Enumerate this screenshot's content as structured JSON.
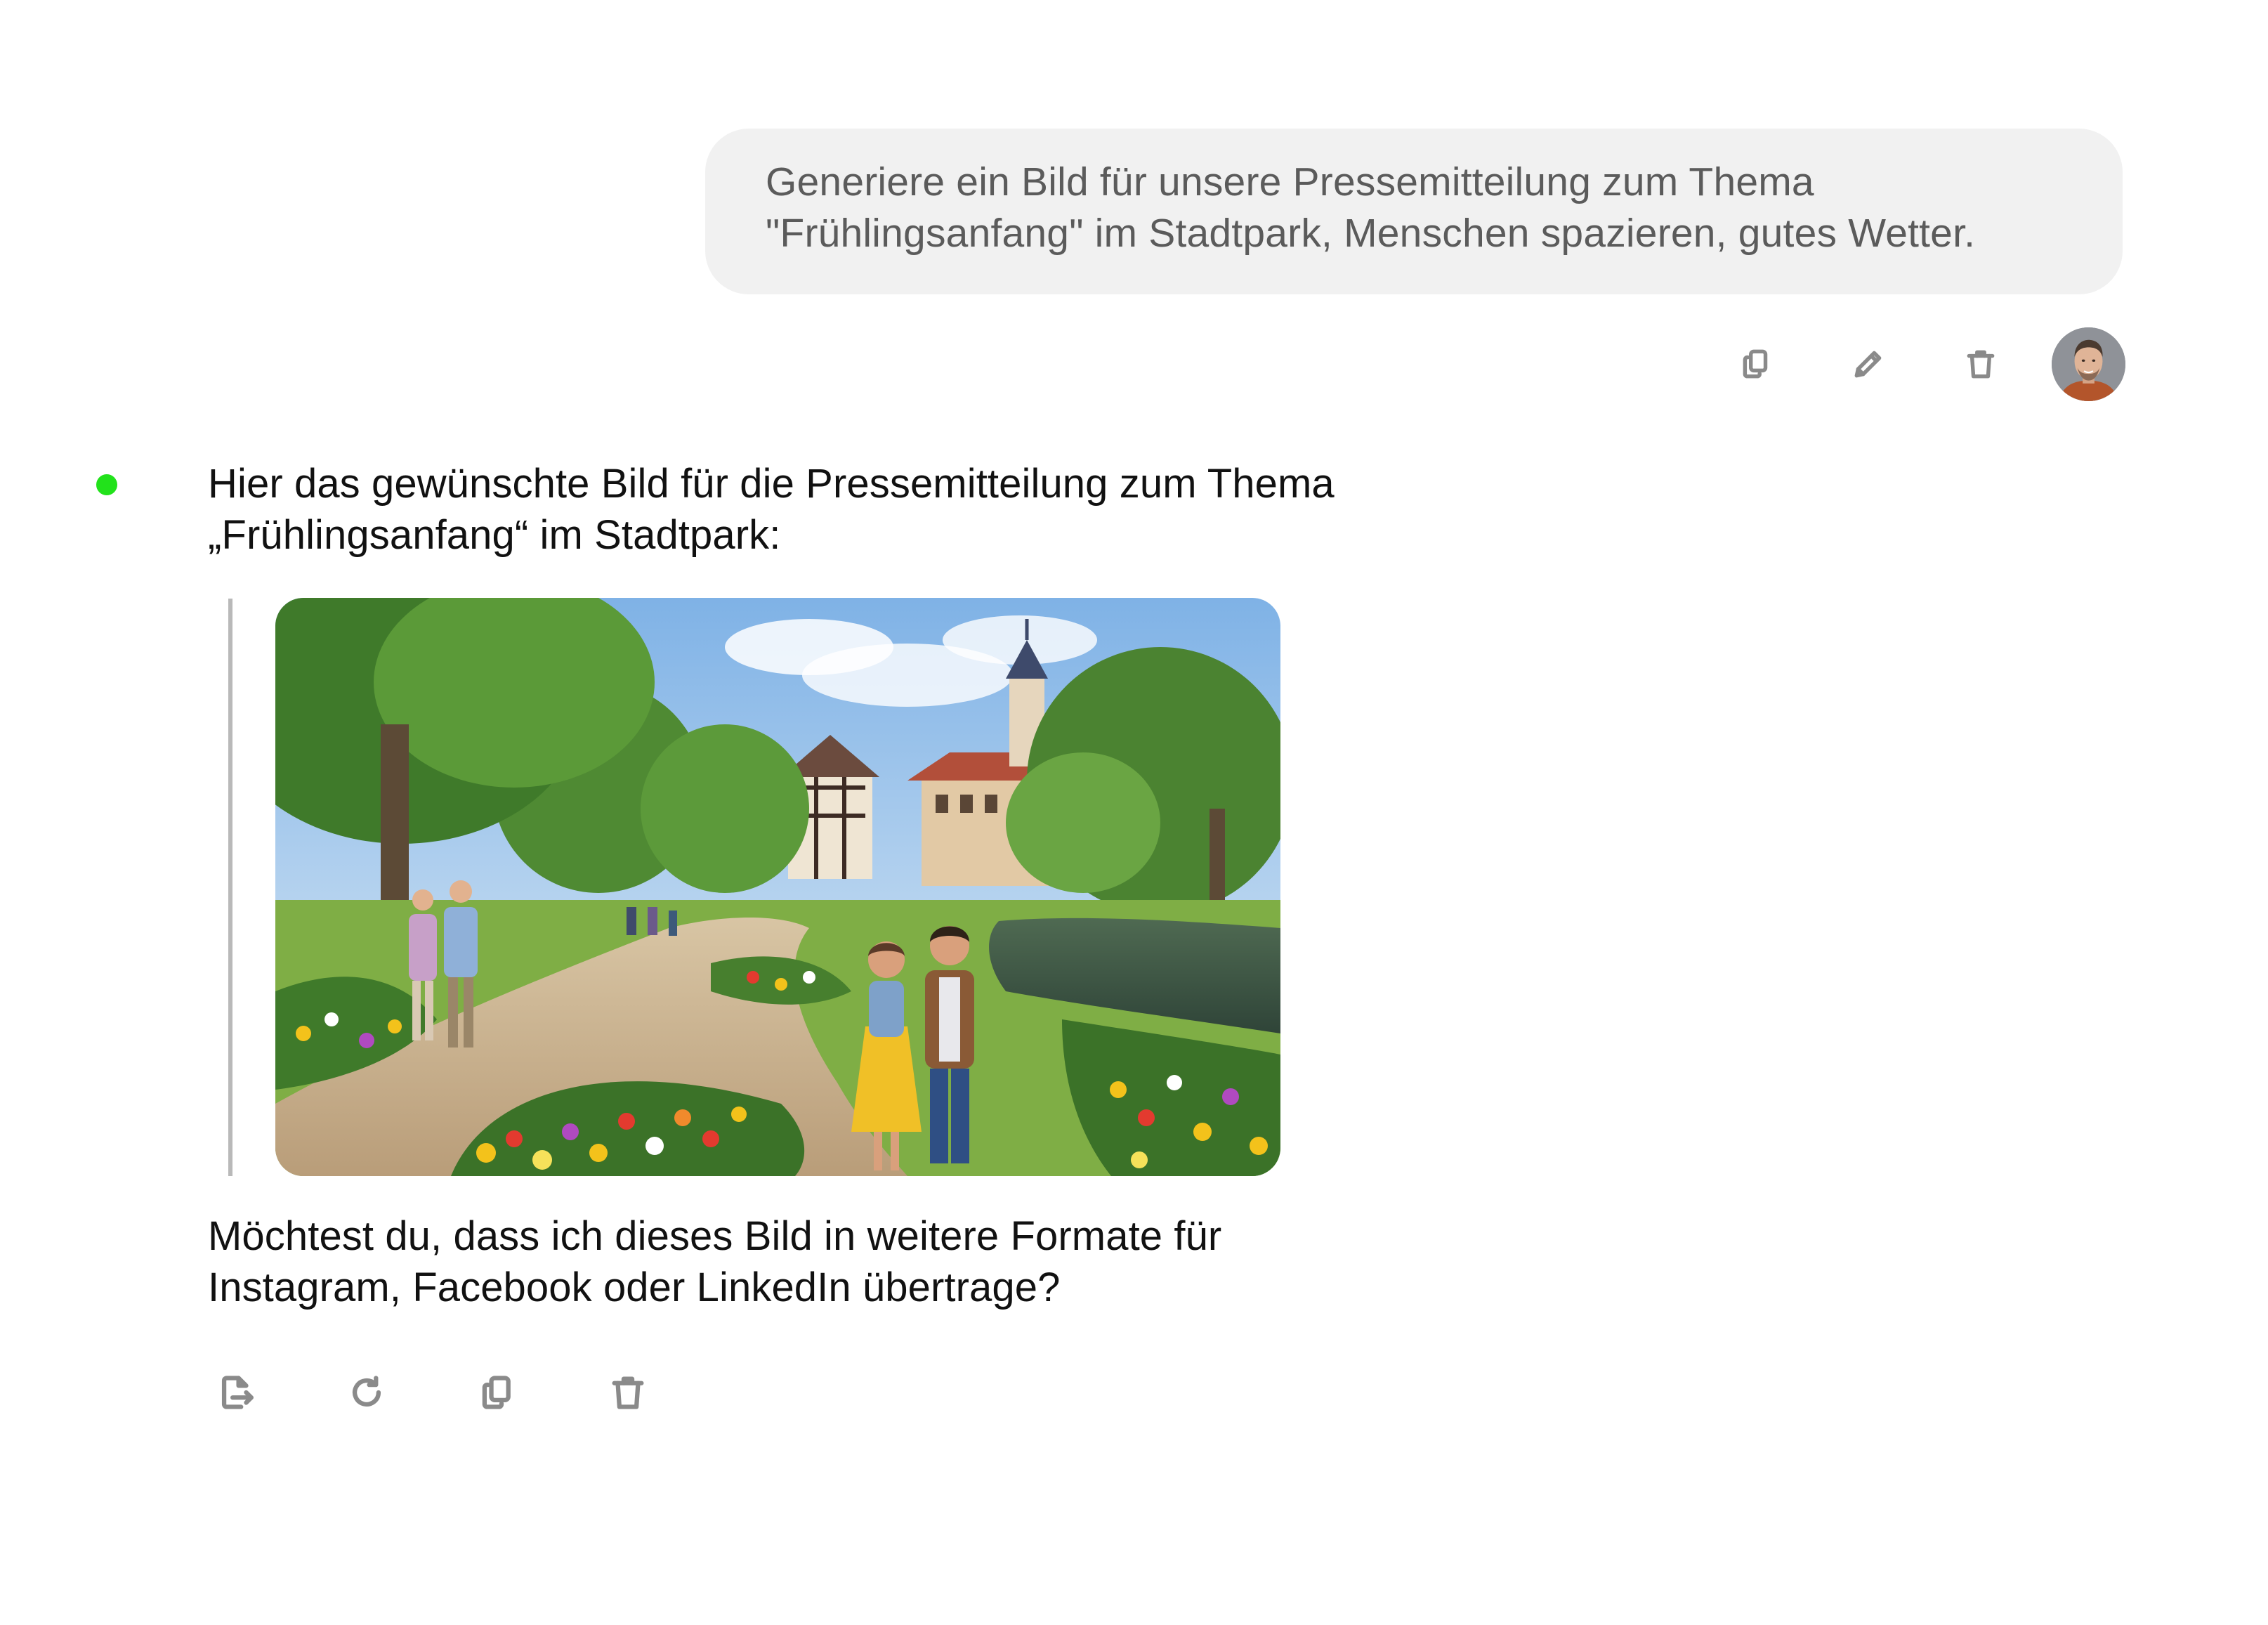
{
  "user_message": {
    "lines": [
      "Generiere ein Bild für unsere Pressemitteilung zum Thema",
      "\"Frühlingsanfang\" im Stadtpark, Menschen spazieren, gutes Wetter."
    ],
    "actions": [
      "copy-icon",
      "edit-icon",
      "trash-icon"
    ]
  },
  "assistant_message": {
    "intro_lines": [
      "Hier das gewünschte Bild für die Pressemitteilung zum Thema",
      "„Frühlingsanfang“ im Stadtpark:"
    ],
    "question_lines": [
      "Möchtest du, dass ich dieses Bild in weitere Formate für",
      "Instagram, Facebook oder LinkedIn übertrage?"
    ],
    "actions": [
      "export-icon",
      "regenerate-icon",
      "copy-icon",
      "trash-icon"
    ]
  },
  "colors": {
    "status_dot": "#22e21b",
    "bubble_bg": "#f1f1f1",
    "icon": "#8a8a8a"
  }
}
